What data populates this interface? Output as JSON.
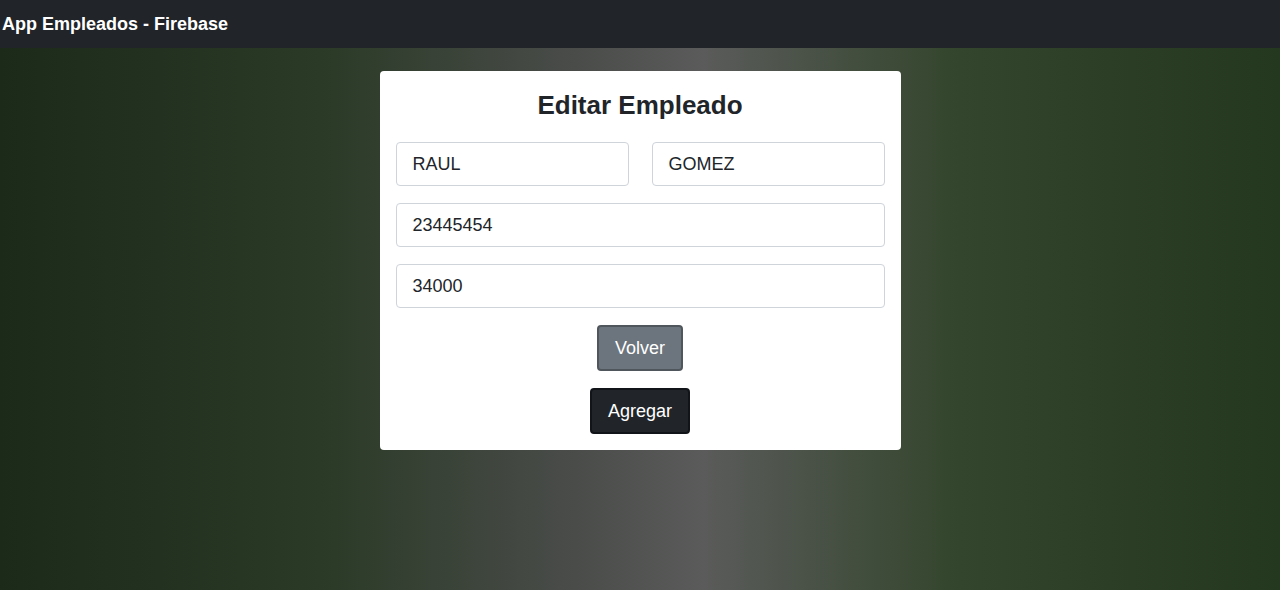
{
  "navbar": {
    "brand": "App Empleados - Firebase"
  },
  "form": {
    "title": "Editar Empleado",
    "fields": [
      {
        "value": "RAUL"
      },
      {
        "value": "GOMEZ"
      },
      {
        "value": "23445454"
      },
      {
        "value": "34000"
      }
    ]
  },
  "buttons": [
    {
      "label": "Volver",
      "kind": "secondary"
    },
    {
      "label": "Agregar",
      "kind": "primary"
    }
  ]
}
